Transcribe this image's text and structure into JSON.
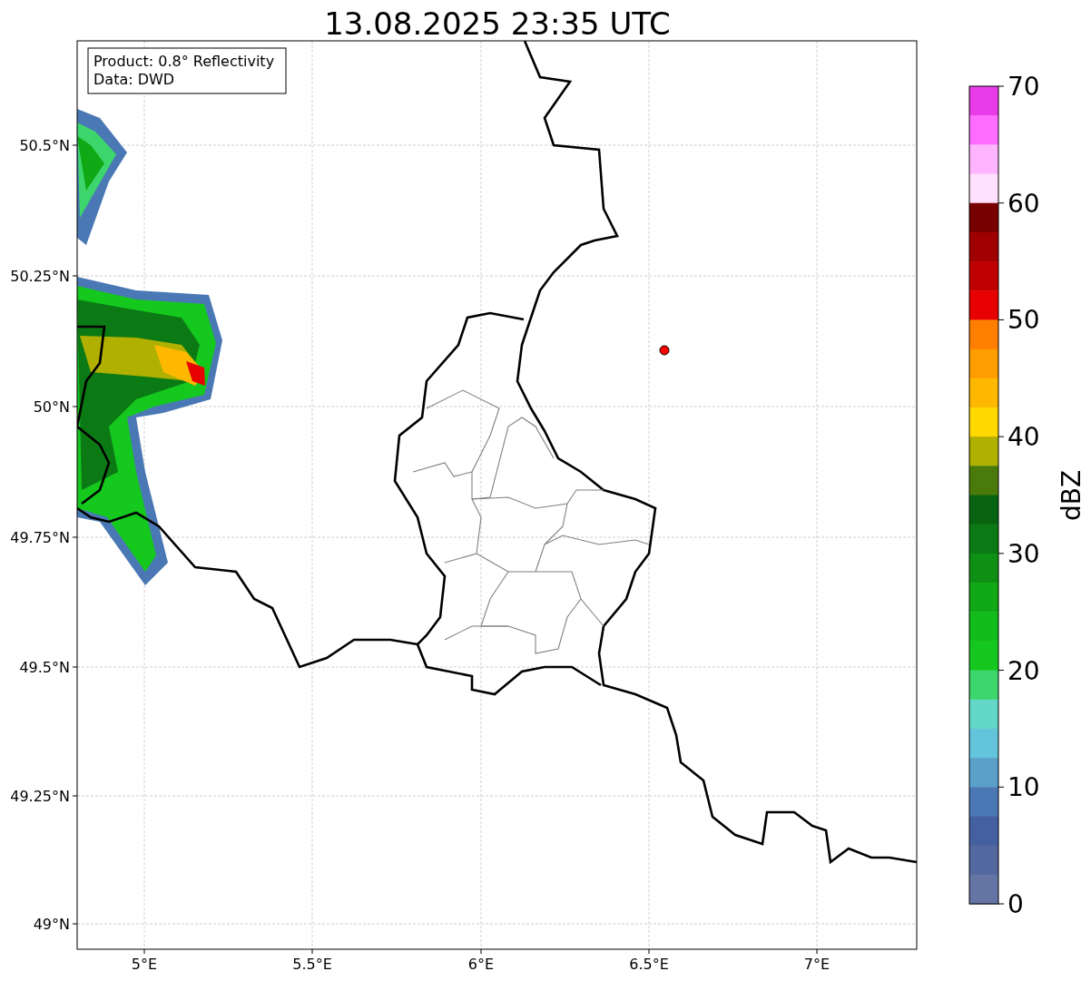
{
  "title": "13.08.2025 23:35 UTC",
  "info_box": [
    "Product: 0.8° Reflectivity",
    "Data: DWD"
  ],
  "lat_labels": [
    "50.5°N",
    "50.25°N",
    "50°N",
    "49.75°N",
    "49.5°N",
    "49.25°N",
    "49°N"
  ],
  "lon_labels": [
    "5°E",
    "5.5°E",
    "6°E",
    "6.5°E",
    "7°E"
  ],
  "colorbar": {
    "label": "dBZ",
    "ticks": [
      "70",
      "60",
      "50",
      "40",
      "30",
      "20",
      "10",
      "0"
    ],
    "bins": [
      {
        "color": "#e83ce8"
      },
      {
        "color": "#ff6cff"
      },
      {
        "color": "#ffb4ff"
      },
      {
        "color": "#ffe0ff"
      },
      {
        "color": "#780000"
      },
      {
        "color": "#a00000"
      },
      {
        "color": "#c00000"
      },
      {
        "color": "#e60000"
      },
      {
        "color": "#ff8000"
      },
      {
        "color": "#ff9c00"
      },
      {
        "color": "#ffb800"
      },
      {
        "color": "#ffd800"
      },
      {
        "color": "#b0b000"
      },
      {
        "color": "#4a7a0a"
      },
      {
        "color": "#086410"
      },
      {
        "color": "#0c7a14"
      },
      {
        "color": "#0e9014"
      },
      {
        "color": "#10a814"
      },
      {
        "color": "#12bc1a"
      },
      {
        "color": "#14c81e"
      },
      {
        "color": "#3cd66c"
      },
      {
        "color": "#64d8c8"
      },
      {
        "color": "#64c4dc"
      },
      {
        "color": "#5aa0c8"
      },
      {
        "color": "#4a78b4"
      },
      {
        "color": "#4460a0"
      },
      {
        "color": "#5468a0"
      },
      {
        "color": "#6474a4"
      }
    ]
  }
}
